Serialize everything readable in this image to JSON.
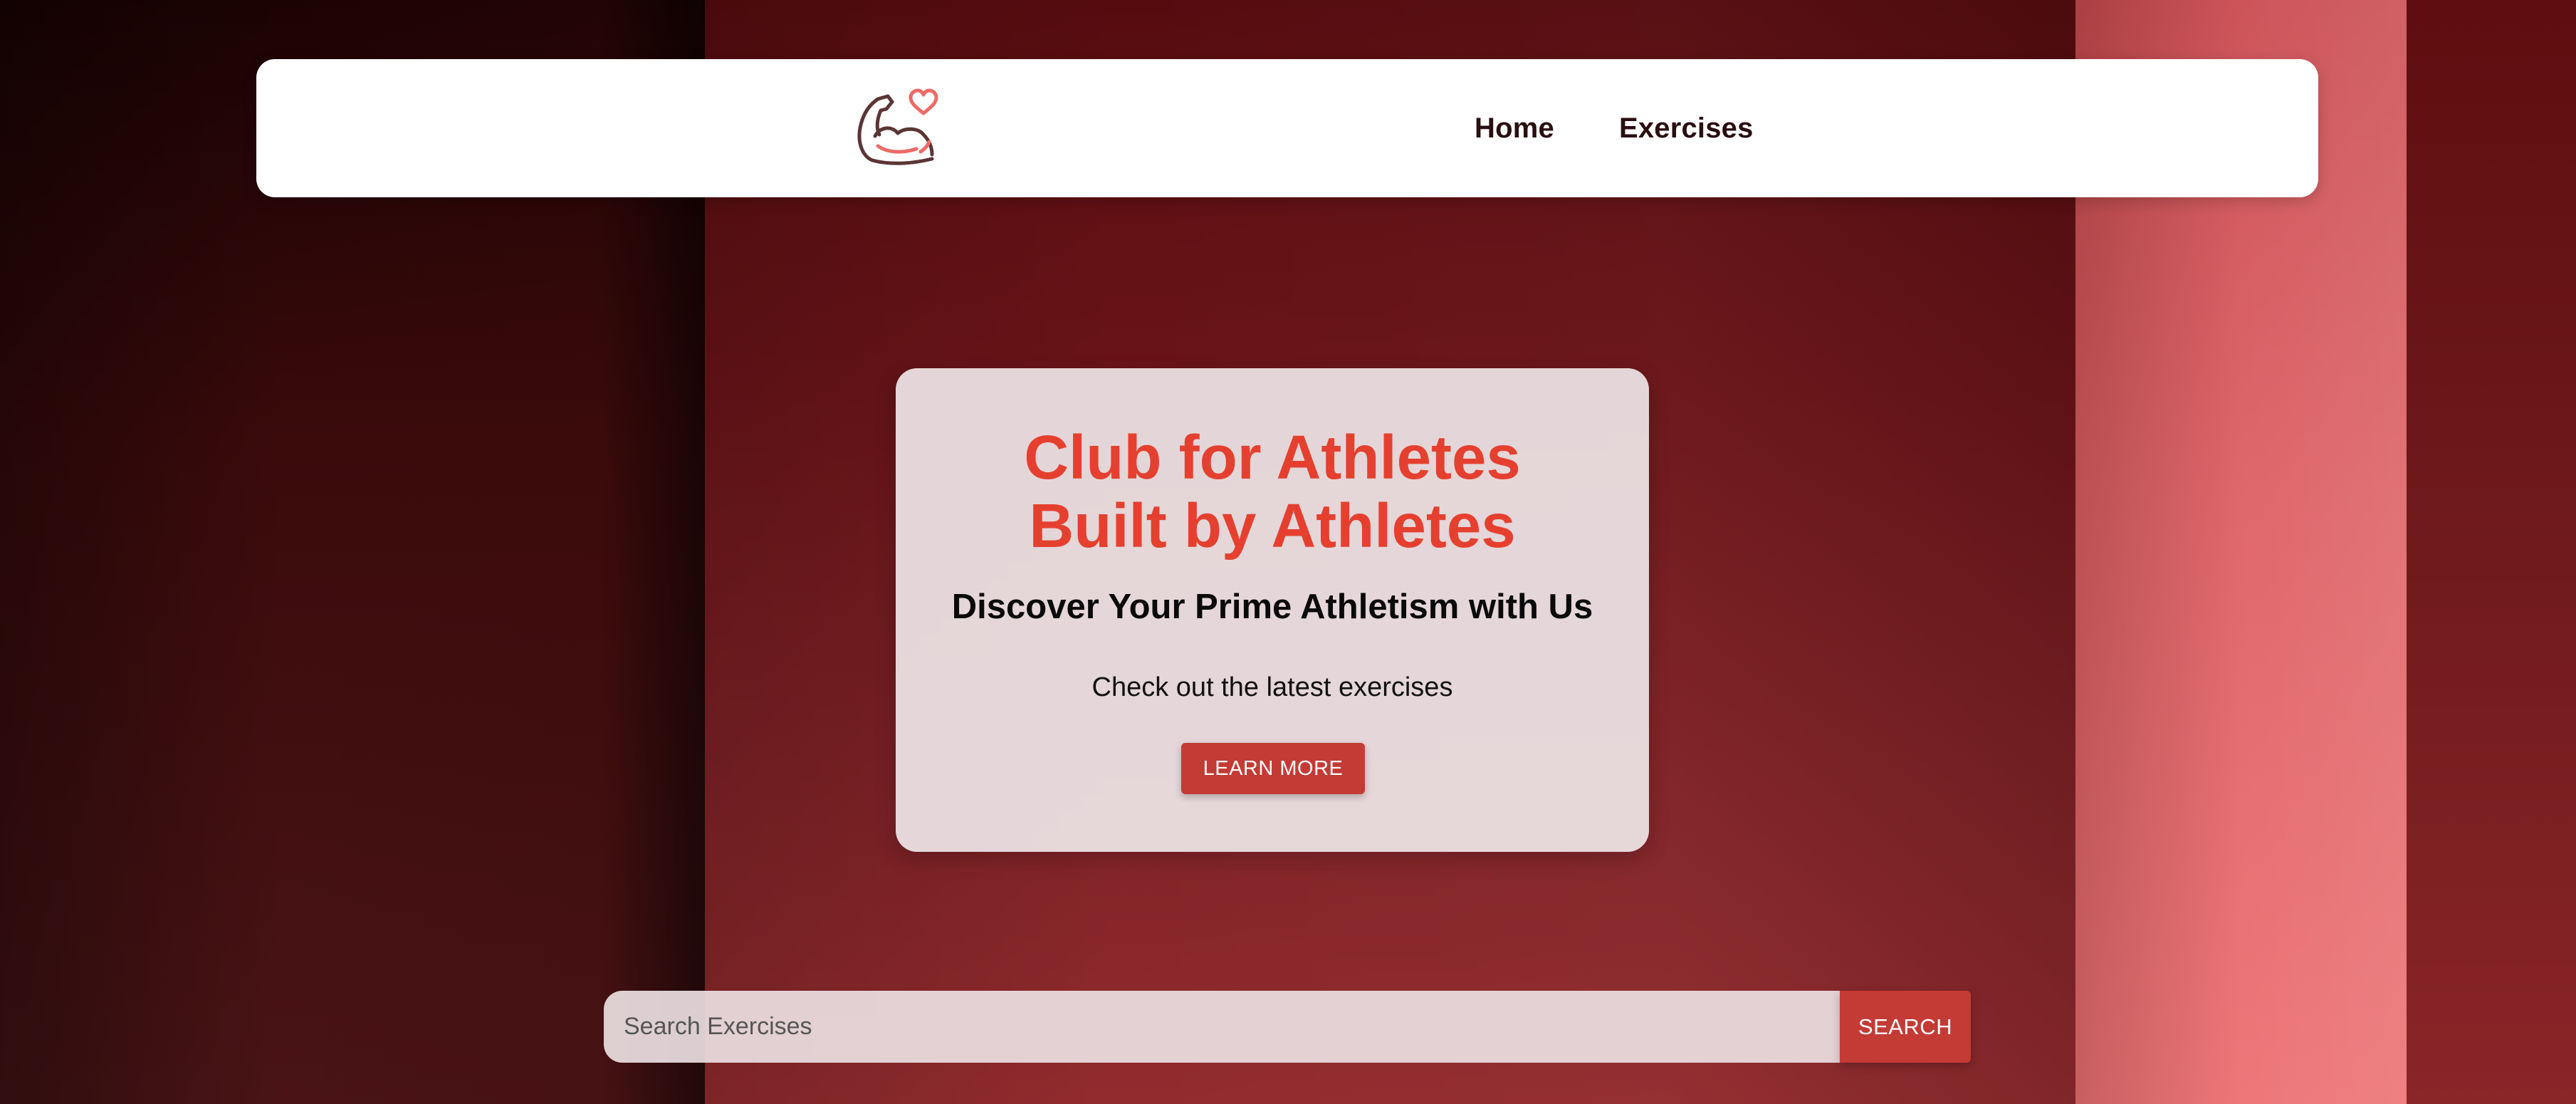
{
  "brand": {
    "logo_icon": "flexed-bicep-heart-icon",
    "colors": {
      "accent": "#e5402f",
      "button": "#c43a35",
      "logo_outline": "#5b3535",
      "logo_accent": "#ee6a66"
    }
  },
  "nav": {
    "items": [
      {
        "label": "Home"
      },
      {
        "label": "Exercises"
      }
    ]
  },
  "hero": {
    "title_line1": "Club for Athletes",
    "title_line2": "Built by Athletes",
    "subtitle": "Discover Your Prime Athletism with Us",
    "text": "Check out the latest exercises",
    "button_label": "LEARN MORE"
  },
  "search": {
    "placeholder": "Search Exercises",
    "value": "",
    "button_label": "SEARCH"
  }
}
